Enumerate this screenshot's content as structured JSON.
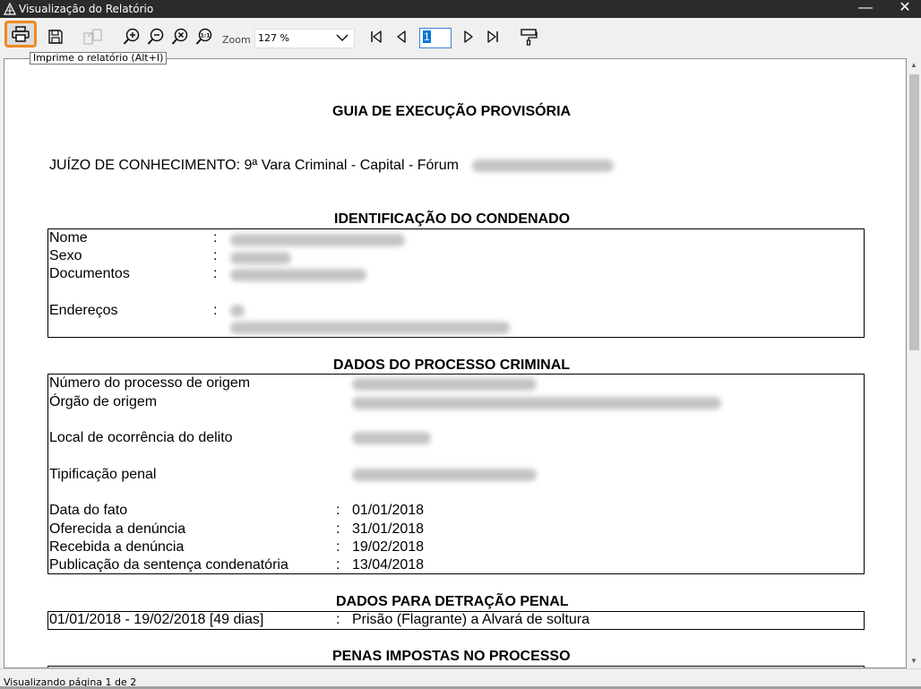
{
  "window": {
    "title": "Visualização do Relatório",
    "minimize_glyph": "—",
    "close_glyph": "✕"
  },
  "toolbar": {
    "buttons": [
      {
        "name": "print",
        "icon": "printer-icon"
      },
      {
        "name": "save",
        "icon": "floppy-icon"
      },
      {
        "name": "export",
        "icon": "export-pages-icon"
      },
      {
        "name": "zoom-in",
        "icon": "zoom-in-icon"
      },
      {
        "name": "zoom-out",
        "icon": "zoom-out-icon"
      },
      {
        "name": "zoom-fit",
        "icon": "zoom-fit-icon"
      },
      {
        "name": "zoom-actual",
        "icon": "zoom-1to1-icon"
      },
      {
        "name": "first-page",
        "icon": "first-page-icon"
      },
      {
        "name": "prev-page",
        "icon": "prev-page-icon"
      },
      {
        "name": "next-page",
        "icon": "next-page-icon"
      },
      {
        "name": "last-page",
        "icon": "last-page-icon"
      },
      {
        "name": "page-setup",
        "icon": "paint-roller-icon"
      }
    ],
    "zoom_label": "Zoom",
    "zoom_value": "127 %",
    "page_value": "1",
    "tooltip": "Imprime o relatório (Alt+I)"
  },
  "report": {
    "title": "GUIA DE EXECUÇÃO PROVISÓRIA",
    "juizo_prefix": "JUÍZO DE CONHECIMENTO: 9ª Vara Criminal - Capital - Fórum",
    "section_condenado": {
      "heading": "IDENTIFICAÇÃO DO CONDENADO",
      "labels": [
        "Nome",
        "Sexo",
        "Documentos",
        "Endereços"
      ],
      "colon": ":"
    },
    "section_processo": {
      "heading": "DADOS DO PROCESSO CRIMINAL",
      "labels": [
        "Número do processo de origem",
        "Órgão de origem",
        "Local de ocorrência do delito",
        "Tipificação penal",
        "Data do fato",
        "Oferecida a denúncia",
        "Recebida a denúncia",
        "Publicação da sentença condenatória"
      ],
      "dates": [
        "01/01/2018",
        "31/01/2018",
        "19/02/2018",
        "13/04/2018"
      ],
      "colon": ":"
    },
    "section_detracao": {
      "heading": "DADOS PARA DETRAÇÃO PENAL",
      "period": "01/01/2018 - 19/02/2018 [49 dias]",
      "description": "Prisão (Flagrante) a Alvará de soltura",
      "colon": ":"
    },
    "section_penas": {
      "heading": "PENAS IMPOSTAS NO PROCESSO"
    }
  },
  "statusbar": {
    "text": "Visualizando página 1 de 2"
  },
  "colors": {
    "titlebar": "#2b2b2b",
    "highlight": "#ef8a23",
    "selection": "#0078d7"
  }
}
